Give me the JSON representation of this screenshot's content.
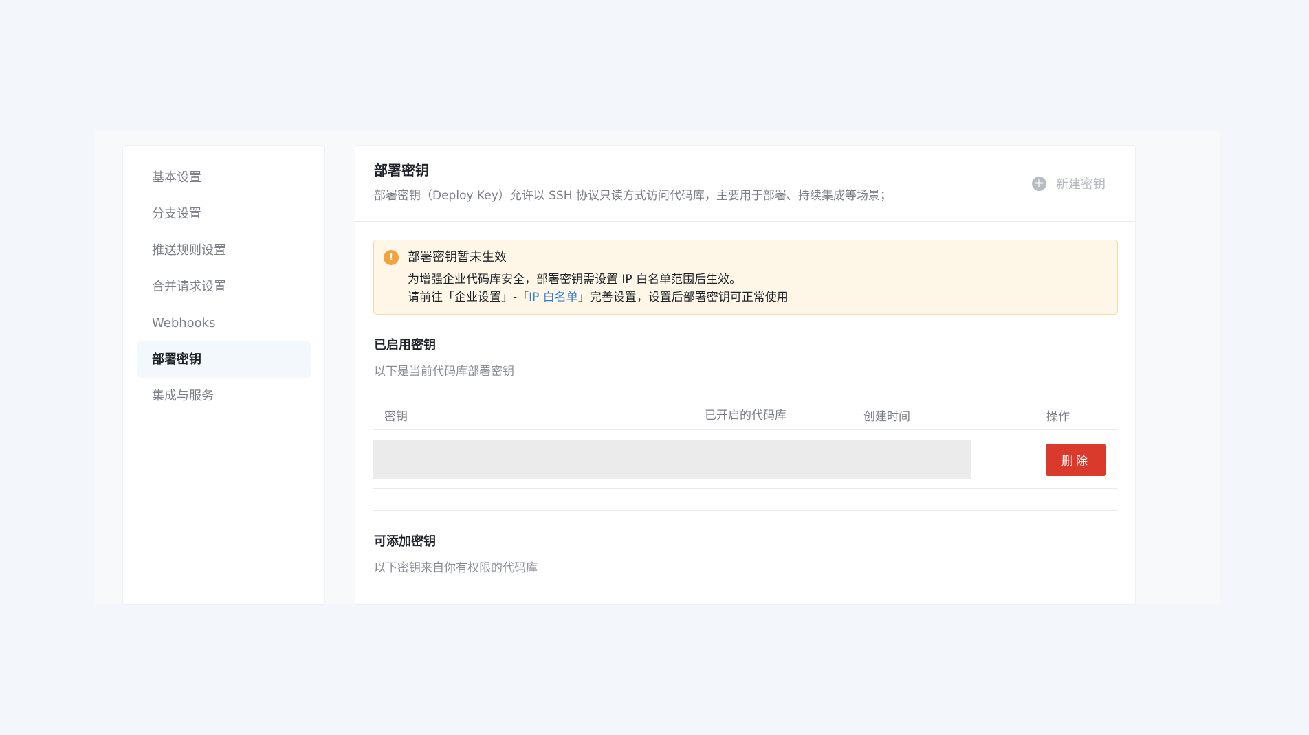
{
  "sidebar": {
    "items": [
      {
        "label": "基本设置"
      },
      {
        "label": "分支设置"
      },
      {
        "label": "推送规则设置"
      },
      {
        "label": "合并请求设置"
      },
      {
        "label": "Webhooks"
      },
      {
        "label": "部署密钥",
        "active": true
      },
      {
        "label": "集成与服务"
      }
    ]
  },
  "header": {
    "title": "部署密钥",
    "description": "部署密钥（Deploy Key）允许以 SSH 协议只读方式访问代码库，主要用于部署、持续集成等场景；",
    "new_key_label": "新建密钥",
    "new_key_icon": "plus-circle-icon"
  },
  "alert": {
    "icon": "warning-icon",
    "title": "部署密钥暂未生效",
    "line1": "为增强企业代码库安全，部署密钥需设置 IP 白名单范围后生效。",
    "line2_prefix": "请前往「企业设置」-「",
    "line2_link": "IP 白名单",
    "line2_suffix": "」完善设置，设置后部署密钥可正常使用",
    "bg_color": "#fef6e7",
    "link_color": "#2f7de1"
  },
  "enabled_keys": {
    "title": "已启用密钥",
    "subtitle": "以下是当前代码库部署密钥",
    "columns": [
      "密钥",
      "已开启的代码库",
      "创建时间",
      "操作"
    ],
    "rows": [
      {
        "delete_label": "删除"
      }
    ]
  },
  "available_keys": {
    "title": "可添加密钥",
    "subtitle": "以下密钥来自你有权限的代码库"
  },
  "colors": {
    "danger": "#d93a2b",
    "active_nav_bg": "#f3f8fd"
  }
}
